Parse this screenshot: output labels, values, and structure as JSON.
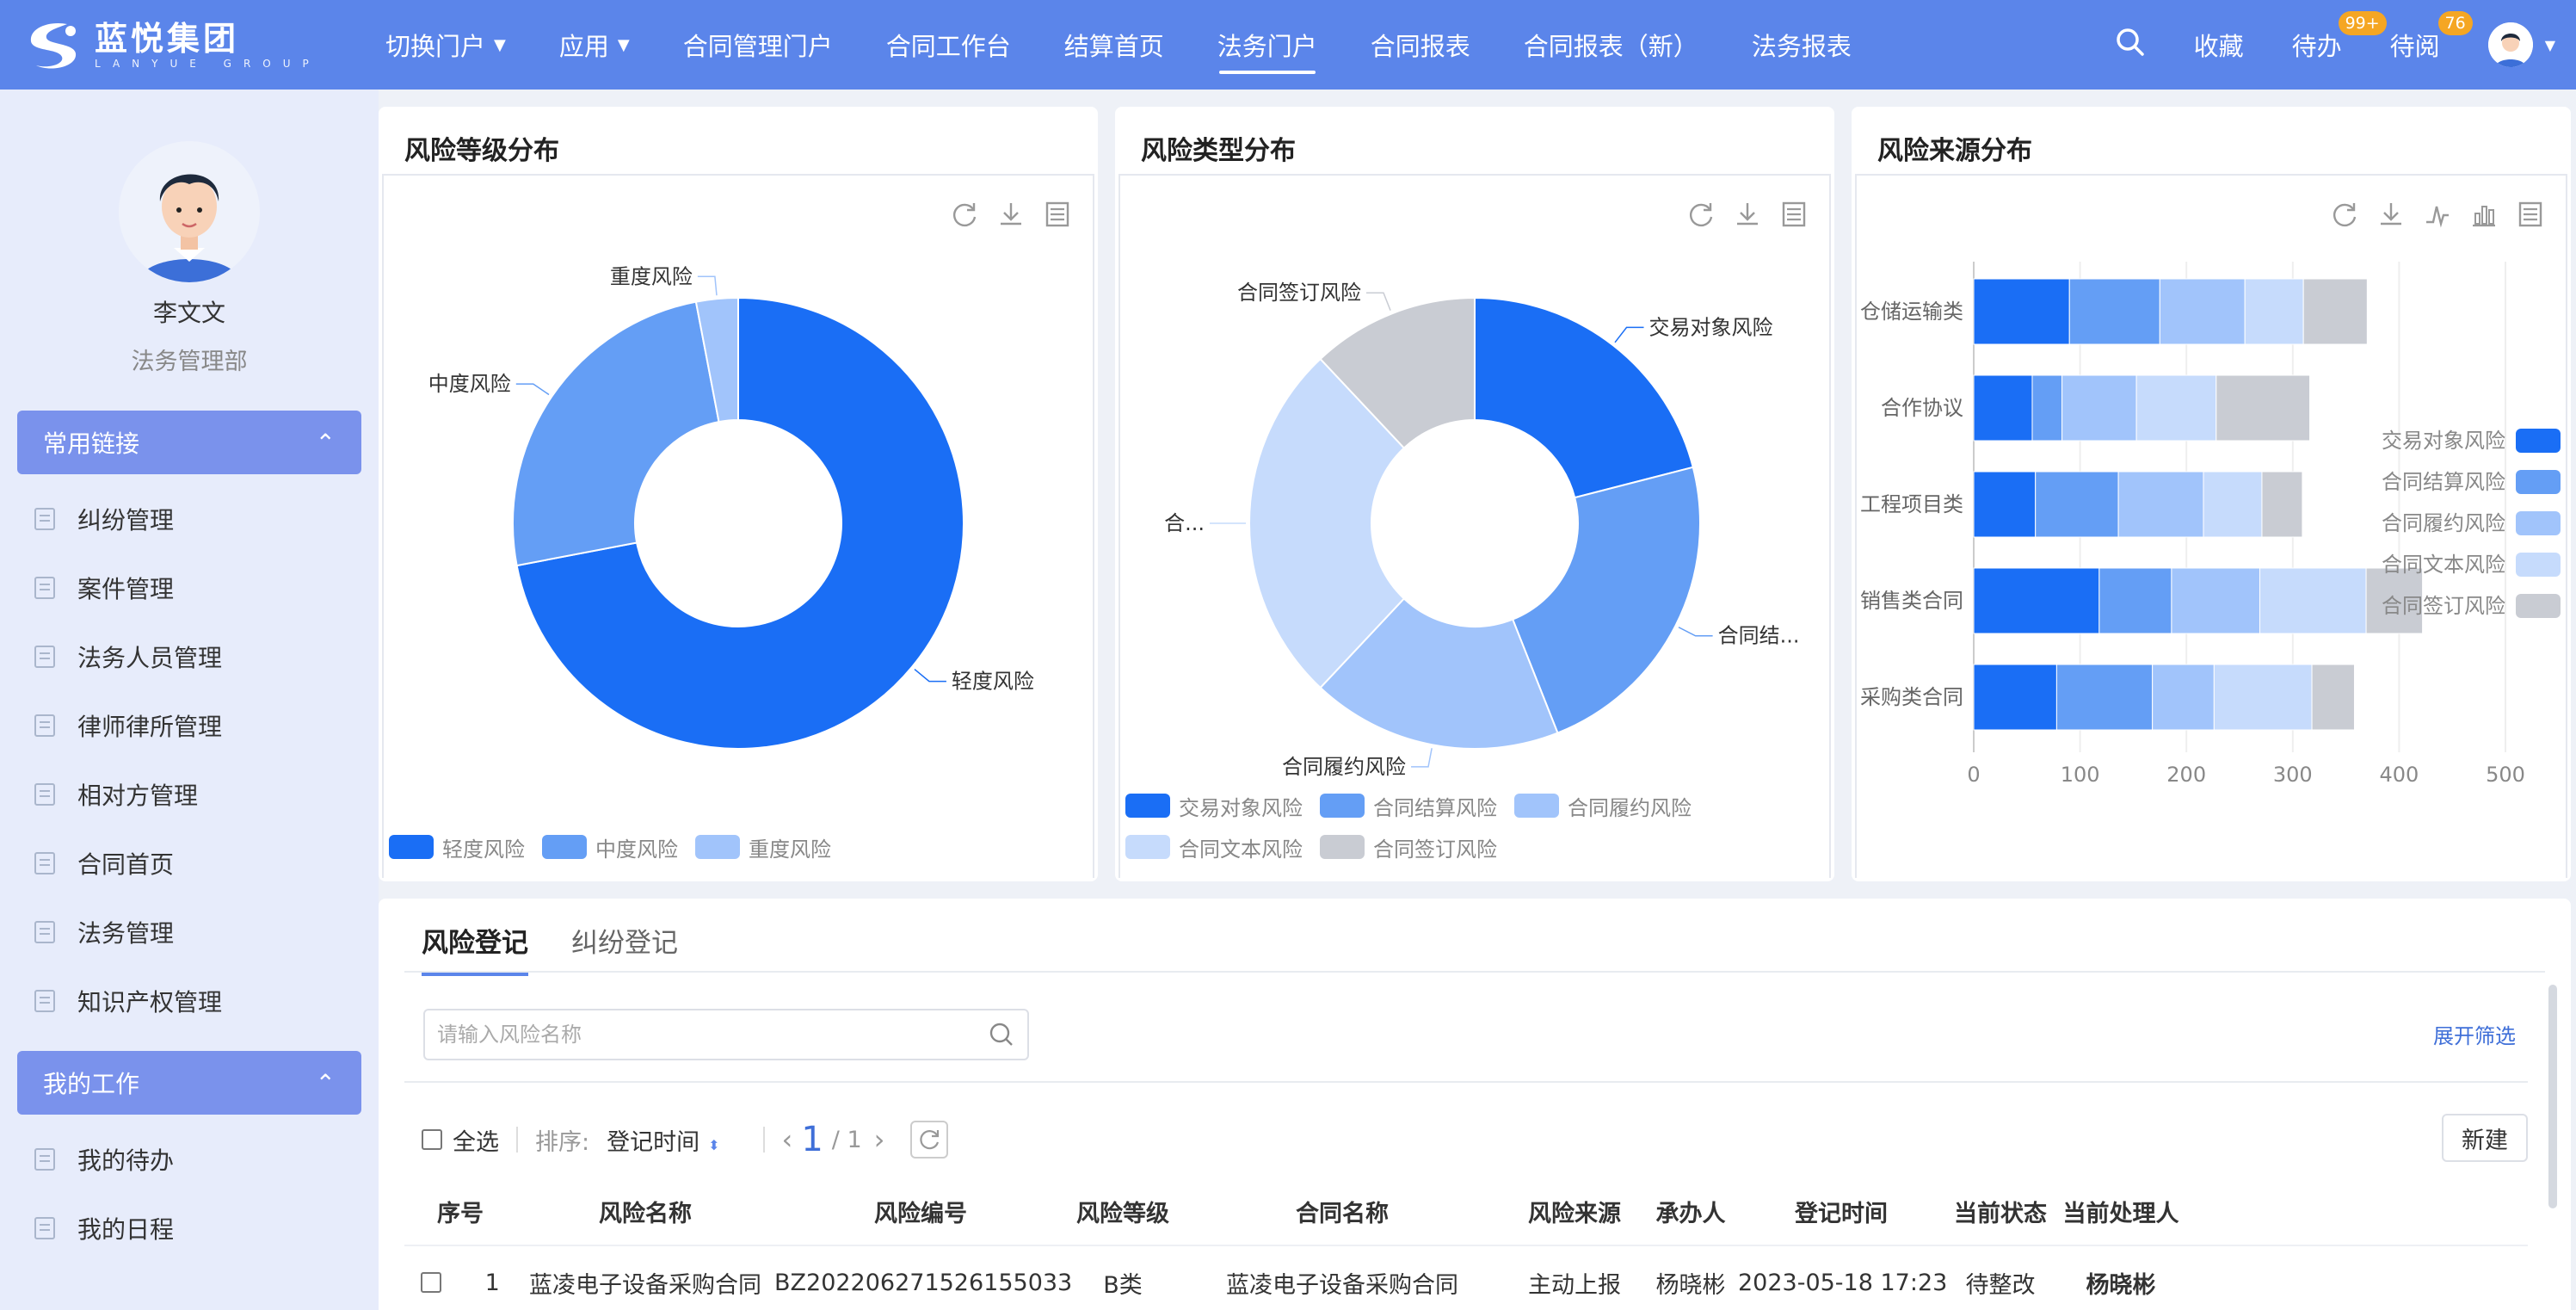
{
  "brand": {
    "name_cn": "蓝悦集团",
    "name_en": "LANYUE GROUP"
  },
  "nav": [
    {
      "label": "切换门户",
      "caret": true
    },
    {
      "label": "应用",
      "caret": true
    },
    {
      "label": "合同管理门户"
    },
    {
      "label": "合同工作台"
    },
    {
      "label": "结算首页"
    },
    {
      "label": "法务门户",
      "active": true
    },
    {
      "label": "合同报表"
    },
    {
      "label": "合同报表（新）"
    },
    {
      "label": "法务报表"
    }
  ],
  "topright": {
    "favorites": "收藏",
    "todo": "待办",
    "todo_badge": "99+",
    "toread": "待阅",
    "toread_badge": "76"
  },
  "profile": {
    "name": "李文文",
    "dept": "法务管理部"
  },
  "sidebar": {
    "group1": "常用链接",
    "group1_items": [
      "纠纷管理",
      "案件管理",
      "法务人员管理",
      "律师律所管理",
      "相对方管理",
      "合同首页",
      "法务管理",
      "知识产权管理"
    ],
    "group2": "我的工作",
    "group2_items": [
      "我的待办",
      "我的日程"
    ]
  },
  "charts": {
    "level": {
      "title": "风险等级分布",
      "chart_data": {
        "type": "pie",
        "labels": [
          "轻度风险",
          "中度风险",
          "重度风险"
        ],
        "values": [
          72,
          25,
          3
        ],
        "colors": [
          "#1a6ef5",
          "#649ef5",
          "#a1c4fb"
        ]
      }
    },
    "type": {
      "title": "风险类型分布",
      "chart_data": {
        "type": "pie",
        "labels": [
          "交易对象风险",
          "合同结算风险",
          "合同履约风险",
          "合同文本风险",
          "合同签订风险"
        ],
        "display_labels": [
          "交易对象风险",
          "合同结...",
          "合同履约风险",
          "合...",
          "合同签订风险"
        ],
        "values": [
          21,
          23,
          18,
          26,
          12
        ],
        "colors": [
          "#1a6ef5",
          "#649ef5",
          "#a1c4fb",
          "#c6dbfc",
          "#c9ccd3"
        ]
      }
    },
    "source": {
      "title": "风险来源分布",
      "chart_data": {
        "type": "bar",
        "orientation": "horizontal",
        "stacked": true,
        "categories": [
          "仓储运输类",
          "合作协议",
          "工程项目类",
          "销售类合同",
          "采购类合同"
        ],
        "series": [
          {
            "name": "交易对象风险",
            "values": [
              90,
              55,
              58,
              118,
              78
            ],
            "color": "#1a6ef5"
          },
          {
            "name": "合同结算风险",
            "values": [
              85,
              28,
              78,
              68,
              90
            ],
            "color": "#649ef5"
          },
          {
            "name": "合同履约风险",
            "values": [
              80,
              70,
              80,
              83,
              58
            ],
            "color": "#a1c4fb"
          },
          {
            "name": "合同文本风险",
            "values": [
              55,
              75,
              55,
              100,
              92
            ],
            "color": "#c6dbfc"
          },
          {
            "name": "合同签订风险",
            "values": [
              60,
              88,
              38,
              53,
              40
            ],
            "color": "#c9ccd3"
          }
        ],
        "xticks": [
          "0",
          "100",
          "200",
          "300",
          "400",
          "500"
        ],
        "xlim": [
          0,
          500
        ]
      }
    }
  },
  "register": {
    "tabs": [
      "风险登记",
      "纠纷登记"
    ],
    "search_placeholder": "请输入风险名称",
    "expand": "展开筛选",
    "select_all": "全选",
    "sort_label": "排序:",
    "sort_value": "登记时间",
    "page_current": "1",
    "page_total": "/ 1",
    "new_button": "新建",
    "columns": [
      "序号",
      "风险名称",
      "风险编号",
      "风险等级",
      "合同名称",
      "风险来源",
      "承办人",
      "登记时间",
      "当前状态",
      "当前处理人"
    ],
    "rows": [
      [
        "1",
        "蓝凌电子设备采购合同",
        "BZ202206271526155033",
        "B类",
        "蓝凌电子设备采购合同",
        "主动上报",
        "杨晓彬",
        "2023-05-18 17:23",
        "待整改",
        "杨晓彬"
      ]
    ]
  }
}
